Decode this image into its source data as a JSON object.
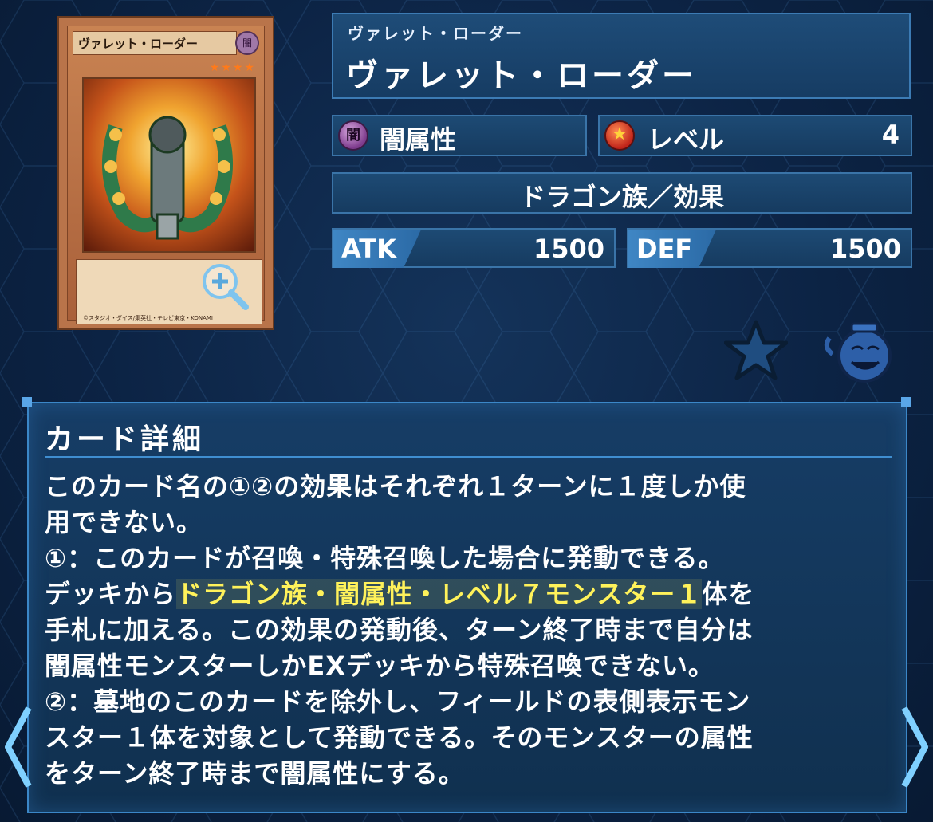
{
  "card": {
    "image_name": "ヴァレット・ローダー",
    "image_attribute": "闇",
    "image_level_stars": "★★★★",
    "image_copyright": "©スタジオ・ダイス/集英社・テレビ東京・KONAMI"
  },
  "title": {
    "ruby": "ヴァレット・ローダー",
    "name": "ヴァレット・ローダー"
  },
  "attribute": {
    "icon_text": "闇",
    "label": "闇属性"
  },
  "level": {
    "label": "レベル",
    "value": "4"
  },
  "type_line": "ドラゴン族／効果",
  "atk": {
    "label": "ATK",
    "value": "1500"
  },
  "def": {
    "label": "DEF",
    "value": "1500"
  },
  "detail": {
    "title": "カード詳細",
    "line1": "このカード名の①②の効果はそれぞれ１ターンに１度しか使",
    "line2": "用できない。",
    "line3": "①：このカードが召喚・特殊召喚した場合に発動できる。",
    "line4_pre": "デッキから",
    "line4_highlight": "ドラゴン族・闇属性・レベル７モンスター１",
    "line4_post": "体を",
    "line5": "手札に加える。この効果の発動後、ターン終了時まで自分は",
    "line6": "闇属性モンスターしかEXデッキから特殊召喚できない。",
    "line7": "②：墓地のこのカードを除外し、フィールドの表側表示モン",
    "line8": "スター１体を対象として発動できる。そのモンスターの属性",
    "line9": "をターン終了時まで闇属性にする。"
  },
  "icons": {
    "zoom": "zoom-in-icon",
    "favorite": "star-icon",
    "pot": "pot-of-greed-icon",
    "prev": "chevron-left-icon",
    "next": "chevron-right-icon"
  },
  "colors": {
    "highlight": "#fff25a",
    "panel_border": "#3b87c8",
    "background": "#0c2344"
  }
}
